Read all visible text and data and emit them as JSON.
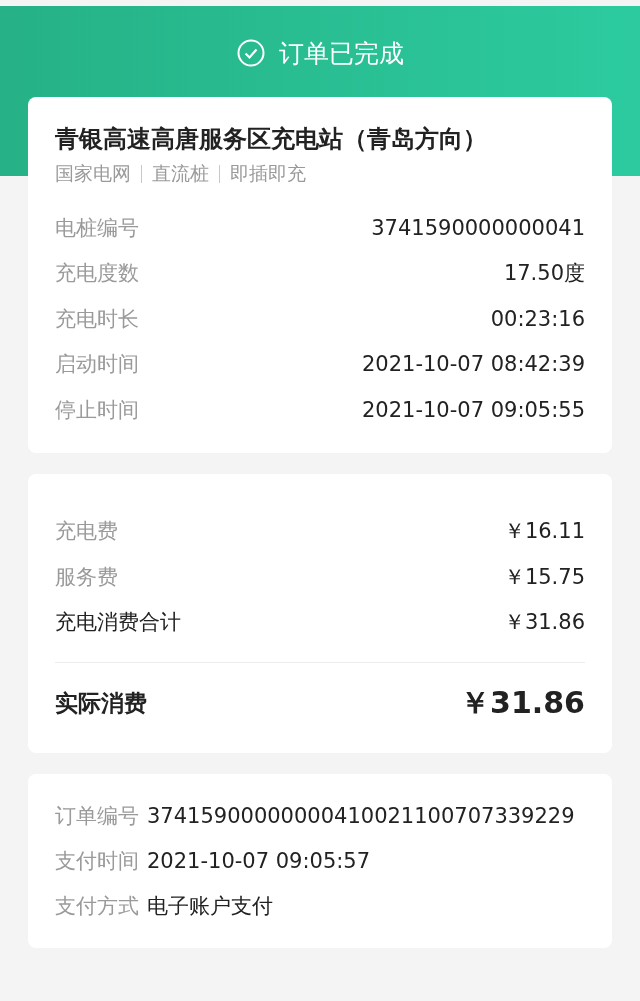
{
  "header": {
    "title": "订单已完成"
  },
  "station": {
    "name": "青银高速高唐服务区充电站（青岛方向）",
    "tags": [
      "国家电网",
      "直流桩",
      "即插即充"
    ],
    "rows": [
      {
        "label": "电桩编号",
        "value": "3741590000000041"
      },
      {
        "label": "充电度数",
        "value": "17.50度"
      },
      {
        "label": "充电时长",
        "value": "00:23:16"
      },
      {
        "label": "启动时间",
        "value": "2021-10-07 08:42:39"
      },
      {
        "label": "停止时间",
        "value": "2021-10-07 09:05:55"
      }
    ]
  },
  "fees": {
    "rows": [
      {
        "label": "充电费",
        "value": "￥16.11",
        "kind": "item"
      },
      {
        "label": "服务费",
        "value": "￥15.75",
        "kind": "item"
      },
      {
        "label": "充电消费合计",
        "value": "￥31.86",
        "kind": "subtotal"
      }
    ],
    "total": {
      "label": "实际消费",
      "value": "￥31.86"
    }
  },
  "payment": {
    "rows": [
      {
        "label": "订单编号",
        "value": "37415900000000410021100707339229"
      },
      {
        "label": "支付时间",
        "value": "2021-10-07 09:05:57"
      },
      {
        "label": "支付方式",
        "value": "电子账户支付"
      }
    ]
  }
}
